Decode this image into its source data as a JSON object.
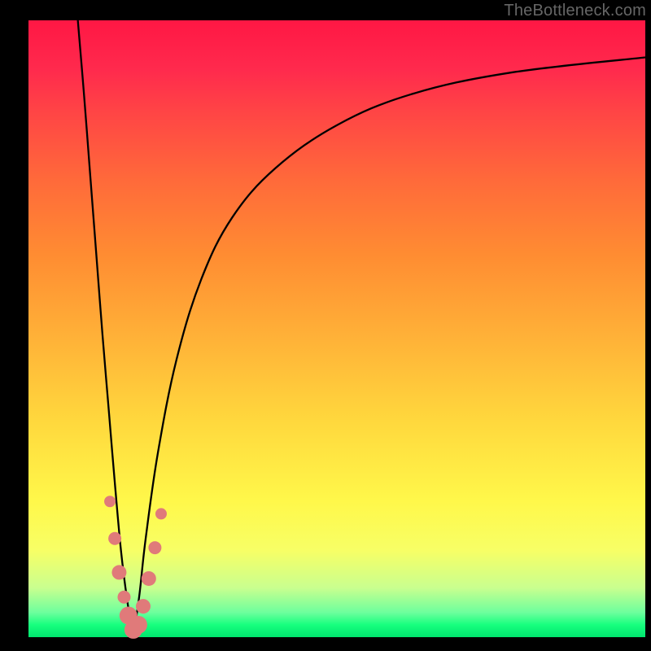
{
  "watermark": "TheBottleneck.com",
  "chart_data": {
    "type": "line",
    "title": "",
    "xlabel": "",
    "ylabel": "",
    "xlim": [
      0,
      100
    ],
    "ylim": [
      0,
      100
    ],
    "note": "Bottleneck-vs-balance curve: sharp V-notch at the optimal point (~x=17) where bottleneck % drops to 0. Background gradient runs red (top, high bottleneck) to green (bottom, zero bottleneck). Two curve branches (below/above the optimum) and salmon markers near the trough.",
    "series": [
      {
        "name": "left-branch",
        "x": [
          8,
          9,
          10,
          11,
          12,
          13,
          14,
          15,
          16,
          17
        ],
        "y": [
          100,
          88,
          75,
          62,
          49,
          37,
          25,
          14,
          6,
          0
        ]
      },
      {
        "name": "right-branch",
        "x": [
          17,
          18,
          19,
          21,
          24,
          28,
          33,
          40,
          50,
          62,
          78,
          100
        ],
        "y": [
          0,
          7,
          16,
          30,
          45,
          58,
          68,
          76,
          83,
          88,
          91.5,
          94
        ]
      }
    ],
    "markers": {
      "name": "sample-points",
      "x": [
        13.2,
        14.0,
        14.7,
        15.5,
        16.2,
        17.0,
        17.8,
        18.6,
        19.5,
        20.5,
        21.5
      ],
      "y": [
        22.0,
        16.0,
        10.5,
        6.5,
        3.5,
        1.2,
        2.0,
        5.0,
        9.5,
        14.5,
        20.0
      ],
      "r": [
        7,
        8,
        9,
        8,
        11,
        11,
        11,
        9,
        9,
        8,
        7
      ]
    }
  }
}
